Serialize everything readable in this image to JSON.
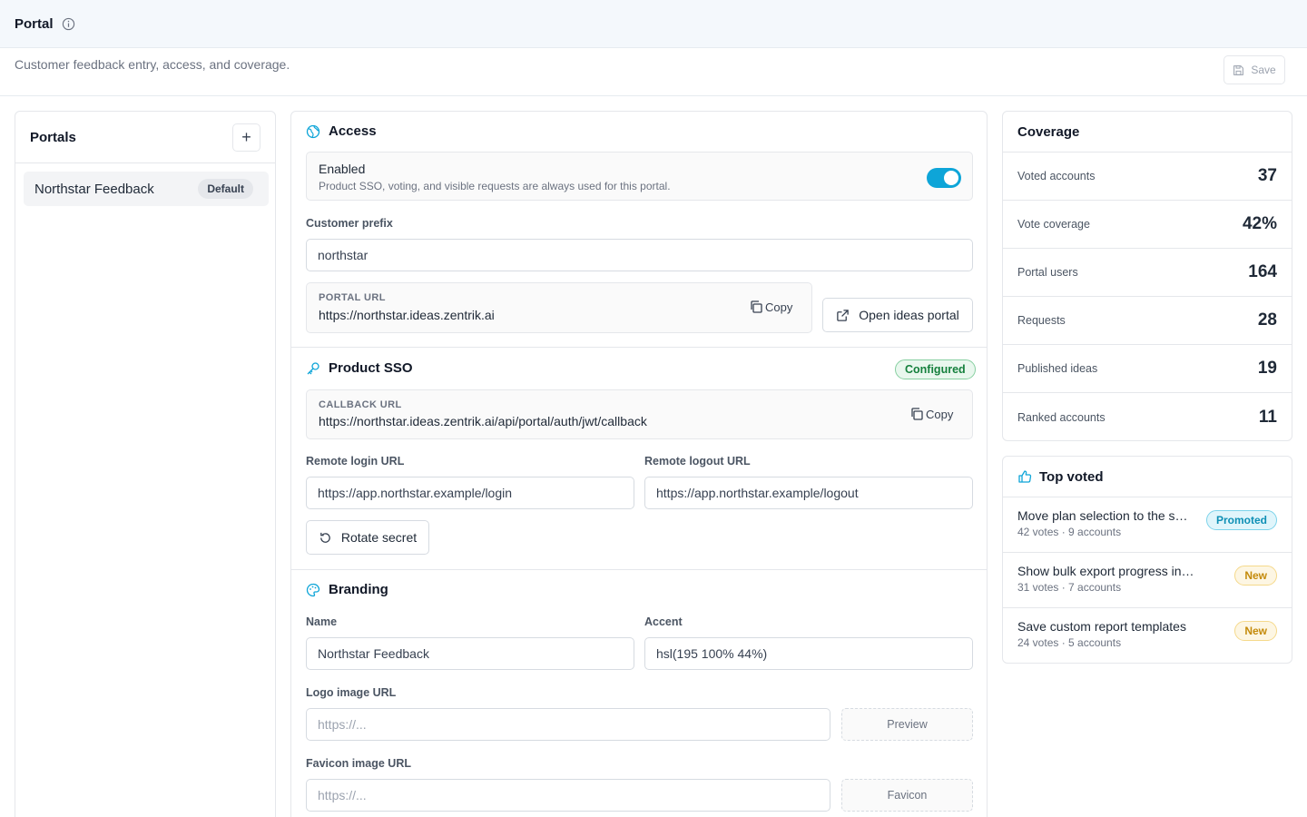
{
  "header": {
    "title": "Portal",
    "description": "Customer feedback entry, access, and coverage.",
    "save_label": "Save"
  },
  "portals": {
    "title": "Portals",
    "add_label": "+",
    "items": [
      {
        "name": "Northstar Feedback",
        "badge": "Default"
      }
    ]
  },
  "access": {
    "title": "Access",
    "enabled_label": "Enabled",
    "enabled_desc": "Product SSO, voting, and visible requests are always used for this portal.",
    "enabled": true,
    "prefix_label": "Customer prefix",
    "prefix_value": "northstar",
    "portal_url_label": "PORTAL URL",
    "portal_url": "https://northstar.ideas.zentrik.ai",
    "copy_label": "Copy",
    "open_label": "Open ideas portal"
  },
  "sso": {
    "title": "Product SSO",
    "status": "Configured",
    "callback_label": "CALLBACK URL",
    "callback_url": "https://northstar.ideas.zentrik.ai/api/portal/auth/jwt/callback",
    "copy_label": "Copy",
    "login_label": "Remote login URL",
    "login_value": "https://app.northstar.example/login",
    "logout_label": "Remote logout URL",
    "logout_value": "https://app.northstar.example/logout",
    "rotate_label": "Rotate secret"
  },
  "branding": {
    "title": "Branding",
    "name_label": "Name",
    "name_value": "Northstar Feedback",
    "accent_label": "Accent",
    "accent_value": "hsl(195 100% 44%)",
    "logo_label": "Logo image URL",
    "logo_placeholder": "https://...",
    "preview_label": "Preview",
    "favicon_label": "Favicon image URL",
    "favicon_placeholder": "https://...",
    "favicon_btn_label": "Favicon"
  },
  "coverage": {
    "title": "Coverage",
    "rows": [
      {
        "label": "Voted accounts",
        "value": "37"
      },
      {
        "label": "Vote coverage",
        "value": "42%"
      },
      {
        "label": "Portal users",
        "value": "164"
      },
      {
        "label": "Requests",
        "value": "28"
      },
      {
        "label": "Published ideas",
        "value": "19"
      },
      {
        "label": "Ranked accounts",
        "value": "11"
      }
    ]
  },
  "top_voted": {
    "title": "Top voted",
    "items": [
      {
        "title": "Move plan selection to the s…",
        "meta": "42 votes · 9 accounts",
        "badge": "Promoted"
      },
      {
        "title": "Show bulk export progress in-pr…",
        "meta": "31 votes · 7 accounts",
        "badge": "New"
      },
      {
        "title": "Save custom report templates",
        "meta": "24 votes · 5 accounts",
        "badge": "New"
      }
    ]
  },
  "colors": {
    "accent": "#0ea5d8",
    "configured": "#15803d",
    "new_badge": "#c48a0a"
  }
}
